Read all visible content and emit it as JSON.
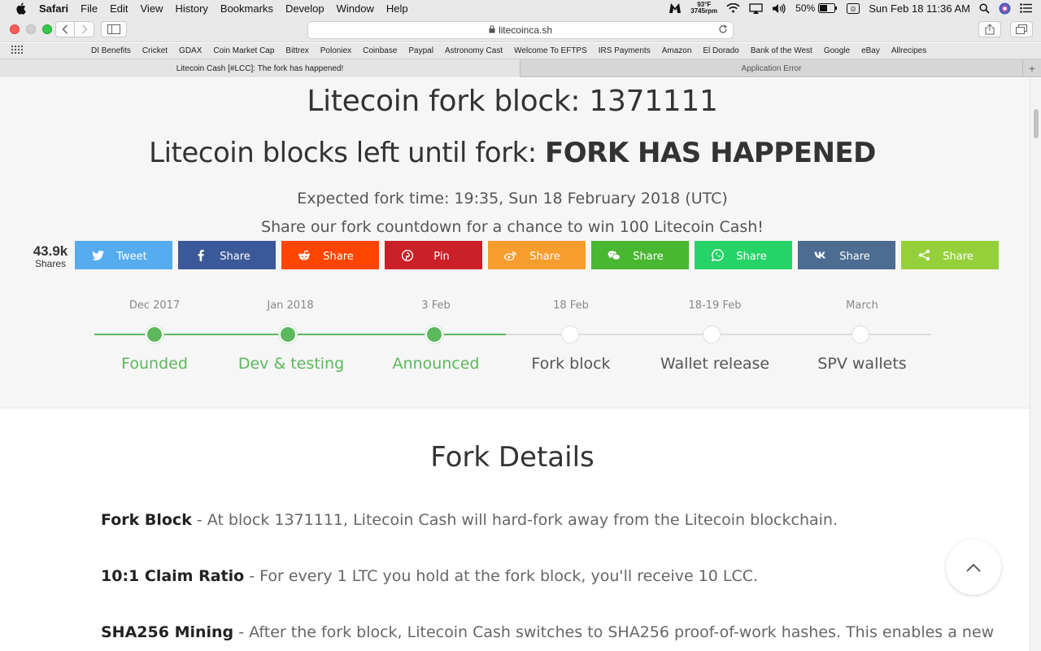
{
  "menubar": {
    "app": "Safari",
    "items": [
      "File",
      "Edit",
      "View",
      "History",
      "Bookmarks",
      "Develop",
      "Window",
      "Help"
    ],
    "temp": "93°F",
    "rpm": "3745rpm",
    "battery": "50%",
    "datetime": "Sun Feb 18  11:36 AM"
  },
  "toolbar": {
    "url": "litecoinca.sh"
  },
  "bookmarks": [
    "DI Benefits",
    "Cricket",
    "GDAX",
    "Coin  Market Cap",
    "Bittrex",
    "Poloniex",
    "Coinbase",
    "Paypal",
    "Astronomy Cast",
    "Welcome To EFTPS",
    "IRS Payments",
    "Amazon",
    "El Dorado",
    "Bank of the West",
    "Google",
    "eBay",
    "Allrecipes"
  ],
  "tabs": {
    "active": "Litecoin Cash [#LCC]: The fork has happened!",
    "inactive": "Application Error"
  },
  "hero": {
    "title": "Litecoin fork block: 1371111",
    "blocks_left_label": "Litecoin blocks left until fork: ",
    "blocks_left_value": "FORK HAS HAPPENED",
    "fork_time": "Expected fork time: 19:35, Sun 18 February 2018 (UTC)",
    "share_cta": "Share our fork countdown for a chance to win 100 Litecoin Cash!"
  },
  "share": {
    "count": "43.9k",
    "count_label": "Shares",
    "buttons": [
      {
        "label": "Tweet",
        "icon": "twitter-icon",
        "color": "#55acee"
      },
      {
        "label": "Share",
        "icon": "facebook-icon",
        "color": "#3b5998"
      },
      {
        "label": "Share",
        "icon": "reddit-icon",
        "color": "#ff4500"
      },
      {
        "label": "Pin",
        "icon": "pinterest-icon",
        "color": "#cb2027"
      },
      {
        "label": "Share",
        "icon": "weibo-icon",
        "color": "#f79d2e"
      },
      {
        "label": "Share",
        "icon": "wechat-icon",
        "color": "#48b731"
      },
      {
        "label": "Share",
        "icon": "whatsapp-icon",
        "color": "#25d366"
      },
      {
        "label": "Share",
        "icon": "vk-icon",
        "color": "#4c6c91"
      },
      {
        "label": "Share",
        "icon": "share-icon",
        "color": "#95d03a"
      }
    ]
  },
  "timeline": [
    {
      "date": "Dec 2017",
      "label": "Founded",
      "done": true
    },
    {
      "date": "Jan 2018",
      "label": "Dev & testing",
      "done": true
    },
    {
      "date": "3 Feb",
      "label": "Announced",
      "done": true
    },
    {
      "date": "18 Feb",
      "label": "Fork block",
      "done": false
    },
    {
      "date": "18-19 Feb",
      "label": "Wallet release",
      "done": false
    },
    {
      "date": "March",
      "label": "SPV wallets",
      "done": false
    }
  ],
  "details": {
    "title": "Fork Details",
    "items": [
      {
        "term": "Fork Block",
        "text": " - At block 1371111, Litecoin Cash will hard-fork away from the Litecoin blockchain."
      },
      {
        "term": "10:1 Claim Ratio",
        "text": " - For every 1 LTC you hold at the fork block, you'll receive 10 LCC."
      },
      {
        "term": "SHA256 Mining",
        "text": " - After the fork block, Litecoin Cash switches to SHA256 proof-of-work hashes. This enables a new"
      }
    ]
  },
  "colors": {
    "accent_green": "#5cb85c"
  }
}
